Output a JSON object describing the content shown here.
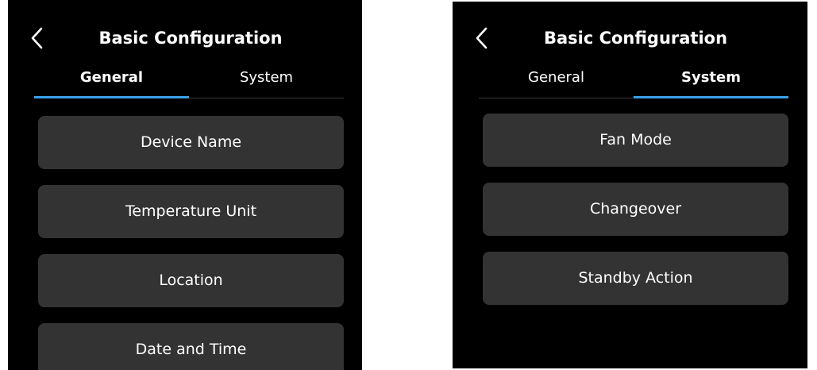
{
  "colors": {
    "background": "#000000",
    "button": "#333333",
    "tab_indicator": "#3aa0e8",
    "text": "#ffffff"
  },
  "left_screen": {
    "title": "Basic Configuration",
    "tabs": [
      {
        "label": "General",
        "active": true
      },
      {
        "label": "System",
        "active": false
      }
    ],
    "items": [
      {
        "label": "Device Name"
      },
      {
        "label": "Temperature Unit"
      },
      {
        "label": "Location"
      },
      {
        "label": "Date and Time"
      }
    ]
  },
  "right_screen": {
    "title": "Basic Configuration",
    "tabs": [
      {
        "label": "General",
        "active": false
      },
      {
        "label": "System",
        "active": true
      }
    ],
    "items": [
      {
        "label": "Fan Mode"
      },
      {
        "label": "Changeover"
      },
      {
        "label": "Standby Action"
      }
    ]
  },
  "icons": {
    "back": "chevron-left-icon"
  }
}
